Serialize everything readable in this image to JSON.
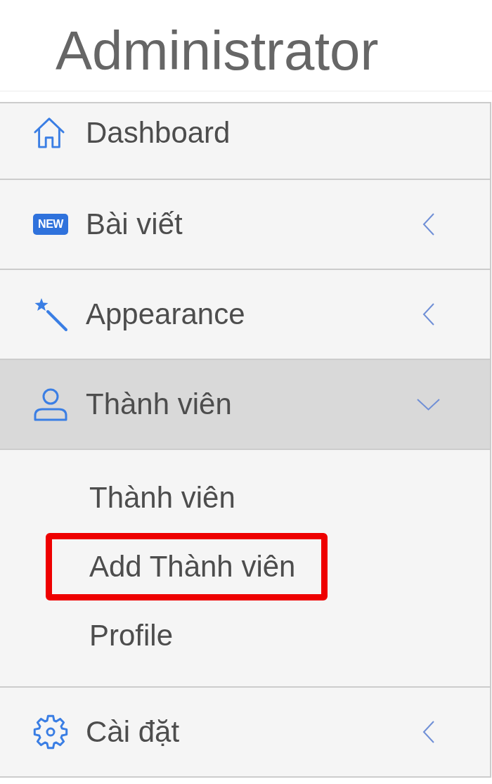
{
  "header": {
    "title": "Administrator"
  },
  "menu": [
    {
      "kind": "link",
      "label": "Dashboard",
      "expanded": false
    },
    {
      "kind": "group",
      "label": "Bài viết",
      "badge": "NEW",
      "expanded": false
    },
    {
      "kind": "group",
      "label": "Appearance",
      "expanded": false
    },
    {
      "kind": "group",
      "label": "Thành viên",
      "expanded": true,
      "children": [
        {
          "label": "Thành viên",
          "highlighted": false
        },
        {
          "label": "Add Thành viên",
          "highlighted": true
        },
        {
          "label": "Profile",
          "highlighted": false
        }
      ]
    },
    {
      "kind": "group",
      "label": "Cài đặt",
      "expanded": false
    }
  ]
}
